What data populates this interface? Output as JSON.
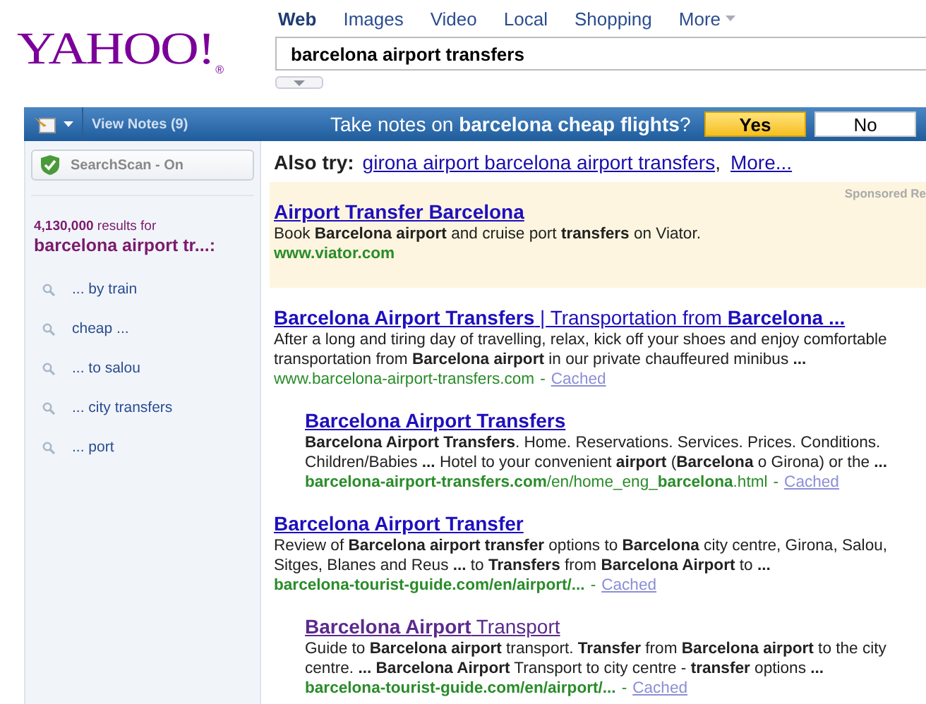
{
  "logo": {
    "text": "YAHOO!",
    "mark": "®"
  },
  "tabs": [
    {
      "label": "Web",
      "selected": true,
      "caret": false
    },
    {
      "label": "Images",
      "selected": false,
      "caret": false
    },
    {
      "label": "Video",
      "selected": false,
      "caret": false
    },
    {
      "label": "Local",
      "selected": false,
      "caret": false
    },
    {
      "label": "Shopping",
      "selected": false,
      "caret": false
    },
    {
      "label": "More",
      "selected": false,
      "caret": true
    }
  ],
  "search": {
    "value": "barcelona airport transfers"
  },
  "notes_bar": {
    "view_notes": "View Notes (9)",
    "prompt": "Take notes on **barcelona cheap flights**?",
    "buttons": [
      {
        "label": "Yes",
        "kind": "primary"
      },
      {
        "label": "No",
        "kind": "plain"
      }
    ]
  },
  "sidebar": {
    "searchscan": "SearchScan - On",
    "count": "**4,130,000** results for",
    "query": "barcelona airport tr...:",
    "suggestions": [
      "... by train",
      "cheap ...",
      "... to salou",
      "... city transfers",
      "... port"
    ]
  },
  "also_try": {
    "label": "Also try:",
    "link": "girona airport barcelona airport transfers",
    "separator": ",",
    "more": "More..."
  },
  "sponsored": {
    "label": "Sponsored Re",
    "title": "Airport Transfer Barcelona",
    "snippet": "Book **Barcelona airport** and cruise port **transfers** on Viator.",
    "url": "www.viator.com"
  },
  "results": [
    {
      "title": "**Barcelona Airport Transfers** | Transportation from **Barcelona ...**",
      "snippet": "After a long and tiring day of travelling, relax, kick off your shoes and enjoy comfortable transportation from **Barcelona airport** in our private chauffeured minibus **...**",
      "url": "www.barcelona-airport-transfers.com",
      "separator": "-",
      "cached": "Cached",
      "indented": false,
      "visited": false
    },
    {
      "title": "**Barcelona Airport Transfers**",
      "snippet": "**Barcelona Airport Transfers**. Home. Reservations. Services. Prices. Conditions. Children/Babies **...** Hotel to your convenient **airport** (**Barcelona** o Girona) or the **...**",
      "url": "**barcelona-airport-transfers.com**/en/home_eng_**barcelona**.html",
      "separator": "-",
      "cached": "Cached",
      "indented": true,
      "visited": false
    },
    {
      "title": "**Barcelona Airport Transfer**",
      "snippet": "Review of **Barcelona airport transfer** options to **Barcelona** city centre, Girona, Salou, Sitges, Blanes and Reus **...** to **Transfers** from **Barcelona Airport** to **...**",
      "url": "**barcelona-tourist-guide.com/en/airport/...**",
      "separator": "-",
      "cached": "Cached",
      "indented": false,
      "visited": false
    },
    {
      "title": "**Barcelona Airport** Transport",
      "snippet": "Guide to **Barcelona airport** transport. **Transfer** from **Barcelona airport** to the city centre. **...** **Barcelona Airport** Transport to city centre - **transfer** options **...**",
      "url": "**barcelona-tourist-guide.com/en/airport/...**",
      "separator": "-",
      "cached": "Cached",
      "indented": true,
      "visited": true
    }
  ]
}
